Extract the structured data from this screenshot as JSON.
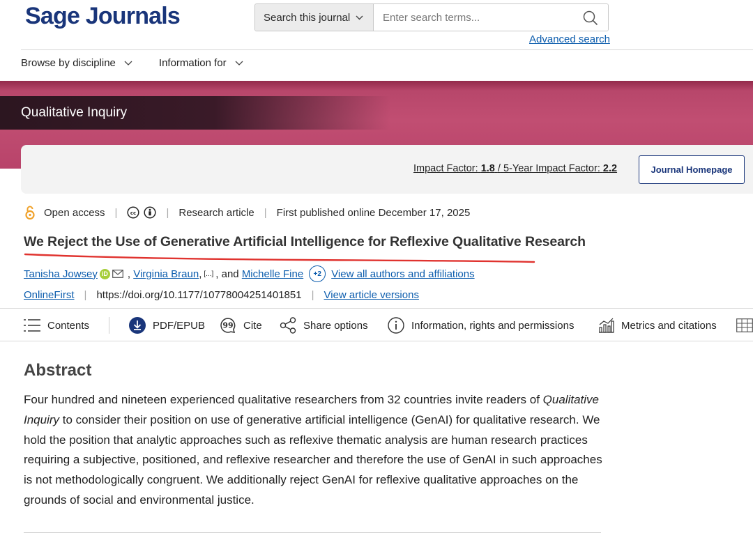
{
  "header": {
    "logo": "Sage Journals",
    "search_scope": "Search this journal",
    "search_placeholder": "Enter search terms...",
    "advanced_search": "Advanced search"
  },
  "nav": {
    "items": [
      {
        "label": "Browse by discipline"
      },
      {
        "label": "Information for"
      }
    ]
  },
  "journal": {
    "name": "Qualitative Inquiry",
    "impact_factor_label": "Impact Factor:",
    "impact_factor_value": "1.8",
    "divider": "/",
    "five_year_label": "5-Year Impact Factor:",
    "five_year_value": "2.2",
    "homepage_button": "Journal Homepage"
  },
  "article": {
    "access": "Open access",
    "type": "Research article",
    "published": "First published online December 17, 2025",
    "title": "We Reject the Use of Generative Artificial Intelligence for Reflexive Qualitative Research",
    "authors": {
      "first": "Tanisha Jowsey",
      "second": "Virginia Braun",
      "ellipsis": "[...]",
      "and": ", and",
      "last": "Michelle Fine",
      "more_badge": "+2",
      "view_all": "View all authors and affiliations"
    },
    "status": "OnlineFirst",
    "doi": "https://doi.org/10.1177/10778004251401851",
    "versions": "View article versions"
  },
  "toolbar": {
    "contents": "Contents",
    "pdf": "PDF/EPUB",
    "cite": "Cite",
    "share": "Share options",
    "info": "Information, rights and permissions",
    "metrics": "Metrics and citations"
  },
  "abstract": {
    "heading": "Abstract",
    "text_before": "Four hundred and nineteen experienced qualitative researchers from 32 countries invite readers of ",
    "journal_italic": "Qualitative Inquiry",
    "text_after": " to consider their position on use of generative artificial intelligence (GenAI) for qualitative research. We hold the position that analytic approaches such as reflexive thematic analysis are human research practices requiring a subjective, positioned, and reflexive researcher and therefore the use of GenAI in such approaches is not methodologically congruent. We additionally reject GenAI for reflexive qualitative approaches on the grounds of social and environmental justice."
  },
  "colors": {
    "brand_navy": "#19357a",
    "banner_pink": "#b8436a",
    "link_blue": "#0b5cad",
    "annotation_red": "#e0332f",
    "orcid_green": "#a6ce39",
    "open_access_orange": "#f0a12a"
  },
  "icons": {
    "search": "search-icon",
    "chevron": "chevron-down-icon",
    "open_access": "open-access-lock-icon",
    "cc": "creative-commons-icon",
    "by": "attribution-icon",
    "orcid": "orcid-icon",
    "mail": "mail-icon",
    "contents": "list-icon",
    "pdf": "download-icon",
    "cite": "quote-icon",
    "share": "share-icon",
    "info": "info-icon",
    "metrics": "bar-chart-icon",
    "table": "table-icon"
  }
}
